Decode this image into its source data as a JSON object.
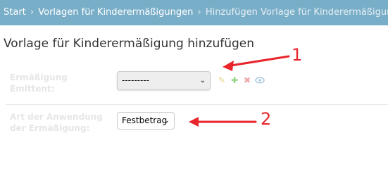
{
  "breadcrumbs": {
    "start": "Start",
    "separator": "›",
    "section": "Vorlagen für Kinderermäßigungen",
    "current": "Hinzufügen Vorlage für Kinderermäßigung"
  },
  "page_title": "Vorlage für Kinderermäßigung hinzufügen",
  "fields": {
    "emittent": {
      "label_line1": "Ermäßigung",
      "label_line2": "Emittent:",
      "selected": "---------",
      "actions": {
        "edit_icon": "pencil-icon",
        "add_icon": "plus-icon",
        "delete_icon": "x-icon",
        "view_icon": "eye-icon"
      }
    },
    "art": {
      "label_line1": "Art der Anwendung",
      "label_line2": "der Ermäßigung:",
      "selected": "Festbetrag"
    }
  },
  "annotations": {
    "marker_1": "1",
    "marker_2": "2",
    "color": "#e8252b"
  },
  "colors": {
    "breadcrumb_bg": "#79aec8"
  }
}
